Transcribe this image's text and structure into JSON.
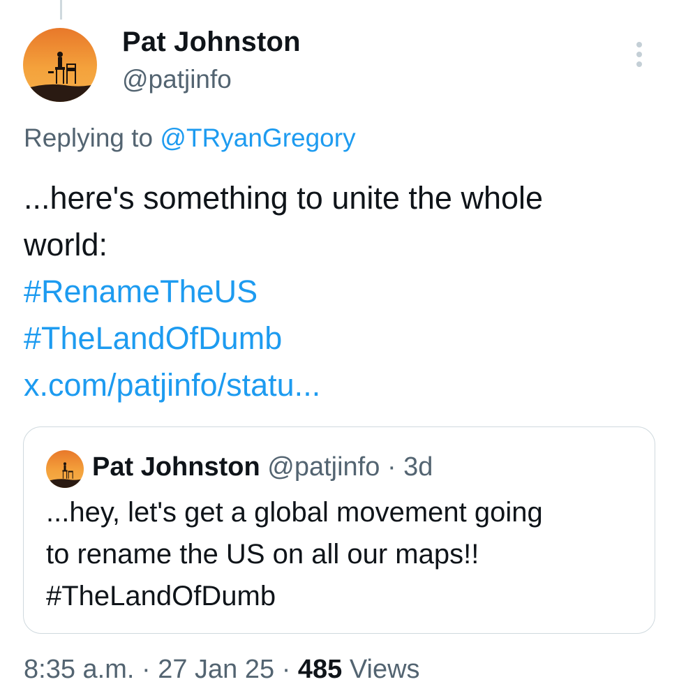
{
  "tweet": {
    "author_name": "Pat Johnston",
    "author_handle": "@patjinfo",
    "replying_prefix": "Replying to",
    "replying_to": "@TRyanGregory",
    "text_line1": "...here's something to unite the whole",
    "text_line2": "world:",
    "hashtag1": "#RenameTheUS",
    "hashtag2": "#TheLandOfDumb",
    "link": "x.com/patjinfo/statu..."
  },
  "quote": {
    "author_name": "Pat Johnston",
    "author_handle": "@patjinfo",
    "separator": "·",
    "age": "3d",
    "text_line1": "...hey, let's get a global movement going",
    "text_line2": "to rename the US on all our maps!!",
    "text_line3": "#TheLandOfDumb"
  },
  "meta": {
    "time": "8:35 a.m.",
    "separator": "·",
    "date": "27 Jan 25",
    "views_count": "485",
    "views_label": "Views"
  },
  "icons": {
    "more": "more-vertical-icon"
  },
  "colors": {
    "link": "#1d9bf0",
    "secondary_text": "#536471",
    "primary_text": "#0f1419",
    "border": "#cfd9de"
  }
}
